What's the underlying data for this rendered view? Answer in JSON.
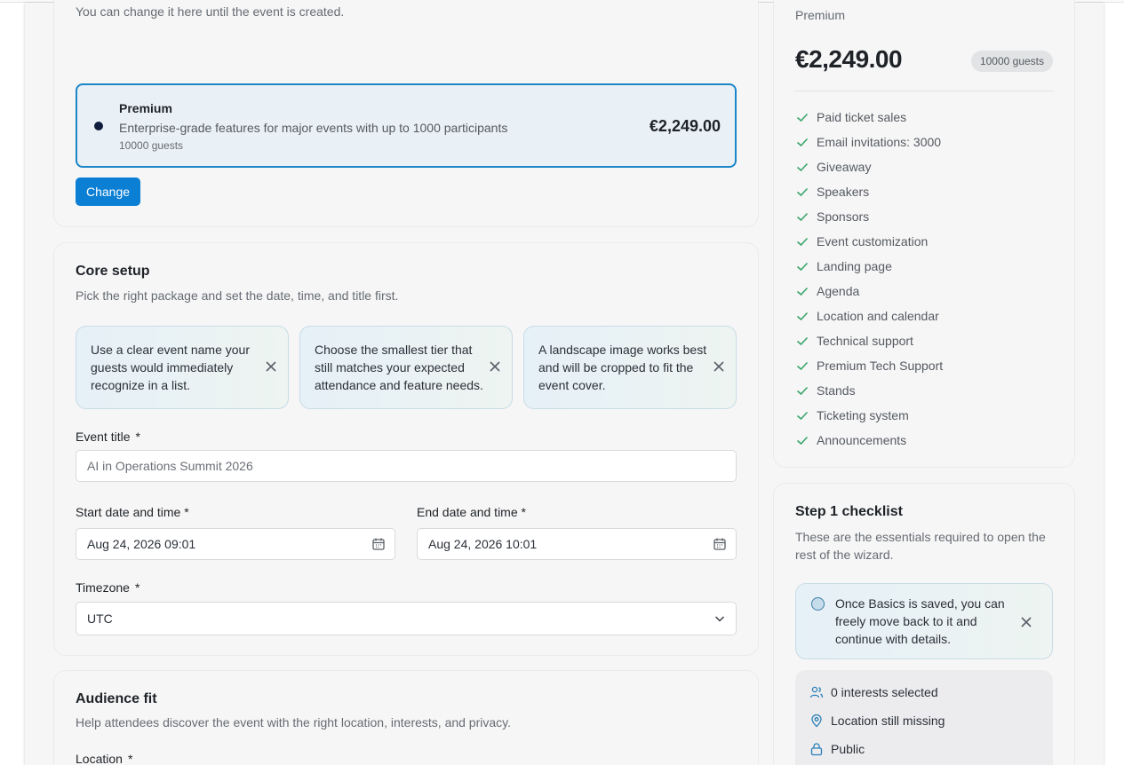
{
  "plan": {
    "hint": "You can change it here until the event is created.",
    "option_name": "Premium",
    "option_desc": "Enterprise-grade features for major events with up to 1000 participants",
    "option_guests": "10000 guests",
    "option_price": "€2,249.00",
    "change_label": "Change"
  },
  "core": {
    "title": "Core setup",
    "subtitle": "Pick the right package and set the date, time, and title first.",
    "tips": [
      "Use a clear event name your guests would immediately recognize in a list.",
      "Choose the smallest tier that still matches your expected attendance and feature needs.",
      "A landscape image works best and will be cropped to fit the event cover."
    ],
    "event_title_label": "Event title",
    "event_title_placeholder": "AI in Operations Summit 2026",
    "start_label": "Start date and time",
    "start_value": "Aug 24, 2026 09:01",
    "end_label": "End date and time",
    "end_value": "Aug 24, 2026 10:01",
    "timezone_label": "Timezone",
    "timezone_value": "UTC",
    "required_mark": "*"
  },
  "audience": {
    "title": "Audience fit",
    "subtitle": "Help attendees discover the event with the right location, interests, and privacy.",
    "location_label": "Location"
  },
  "summary": {
    "tier": "Premium",
    "price": "€2,249.00",
    "guests_badge": "10000 guests",
    "features": [
      "Paid ticket sales",
      "Email invitations: 3000",
      "Giveaway",
      "Speakers",
      "Sponsors",
      "Event customization",
      "Landing page",
      "Agenda",
      "Location and calendar",
      "Technical support",
      "Premium Tech Support",
      "Stands",
      "Ticketing system",
      "Announcements"
    ]
  },
  "checklist": {
    "title": "Step 1 checklist",
    "subtitle": "These are the essentials required to open the rest of the wizard.",
    "note": "Once Basics is saved, you can freely move back to it and continue with details.",
    "interests": "0 interests selected",
    "location": "Location still missing",
    "privacy": "Public"
  },
  "colors": {
    "accent": "#0b7fd4",
    "check_green": "#3aa56b",
    "selected_border": "#1b86c8"
  }
}
